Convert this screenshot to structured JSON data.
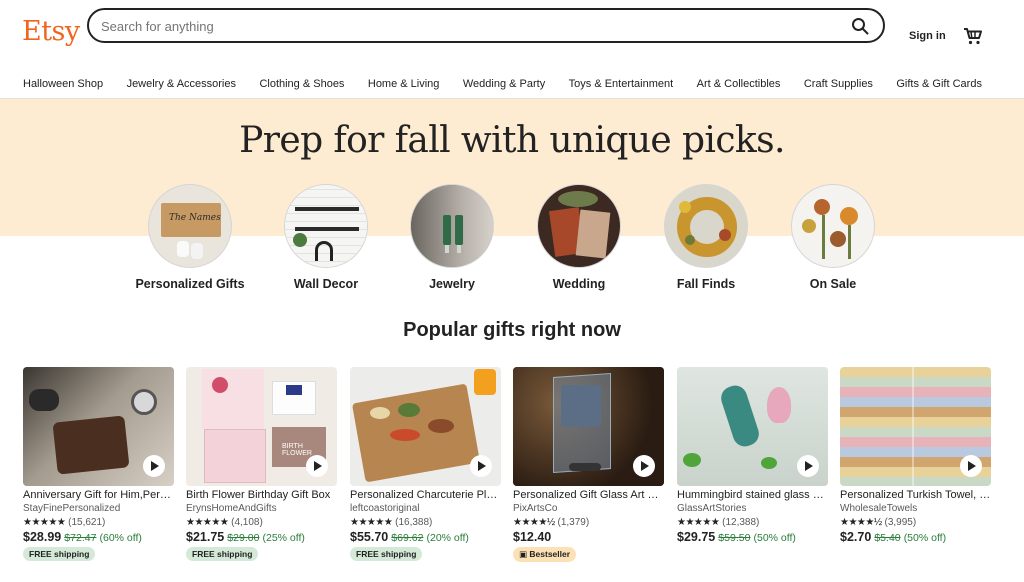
{
  "header": {
    "logo": "Etsy",
    "search_placeholder": "Search for anything",
    "signin": "Sign in"
  },
  "nav": [
    "Halloween Shop",
    "Jewelry & Accessories",
    "Clothing & Shoes",
    "Home & Living",
    "Wedding & Party",
    "Toys & Entertainment",
    "Art & Collectibles",
    "Craft Supplies",
    "Gifts & Gift Cards"
  ],
  "hero": {
    "title": "Prep for fall with unique picks."
  },
  "categories": [
    "Personalized Gifts",
    "Wall Decor",
    "Jewelry",
    "Wedding",
    "Fall Finds",
    "On Sale"
  ],
  "section_title": "Popular gifts right now",
  "products": [
    {
      "title": "Anniversary Gift for Him,Personalized Wallet",
      "shop": "StayFinePersonalized",
      "stars": "★★★★★",
      "reviews": "(15,621)",
      "price": "$28.99",
      "original": "$72.47",
      "discount": "(60% off)",
      "badge": "FREE shipping",
      "badge_type": "free"
    },
    {
      "title": "Birth Flower Birthday Gift Box",
      "shop": "ErynsHomeAndGifts",
      "stars": "★★★★★",
      "reviews": "(4,108)",
      "price": "$21.75",
      "original": "$29.00",
      "discount": "(25% off)",
      "badge": "FREE shipping",
      "badge_type": "free"
    },
    {
      "title": "Personalized Charcuterie Platter",
      "shop": "leftcoastoriginal",
      "stars": "★★★★★",
      "reviews": "(16,388)",
      "price": "$55.70",
      "original": "$69.62",
      "discount": "(20% off)",
      "badge": "FREE shipping",
      "badge_type": "free"
    },
    {
      "title": "Personalized Gift Glass Art Frame",
      "shop": "PixArtsCo",
      "stars": "★★★★½",
      "reviews": "(1,379)",
      "price": "$12.40",
      "original": "",
      "discount": "",
      "badge": "Bestseller",
      "badge_type": "best"
    },
    {
      "title": "Hummingbird stained glass suncatcher",
      "shop": "GlassArtStories",
      "stars": "★★★★★",
      "reviews": "(12,388)",
      "price": "$29.75",
      "original": "$59.50",
      "discount": "(50% off)",
      "badge": "",
      "badge_type": ""
    },
    {
      "title": "Personalized Turkish Towel, Beach Towel",
      "shop": "WholesaleTowels",
      "stars": "★★★★½",
      "reviews": "(3,995)",
      "price": "$2.70",
      "original": "$5.40",
      "discount": "(50% off)",
      "badge": "",
      "badge_type": ""
    }
  ],
  "colors": {
    "brand": "#f1641e",
    "banner": "#fdebd2",
    "sale_green": "#2a7d3a",
    "free_badge": "#d4e9d7",
    "best_badge": "#fce0b6"
  }
}
